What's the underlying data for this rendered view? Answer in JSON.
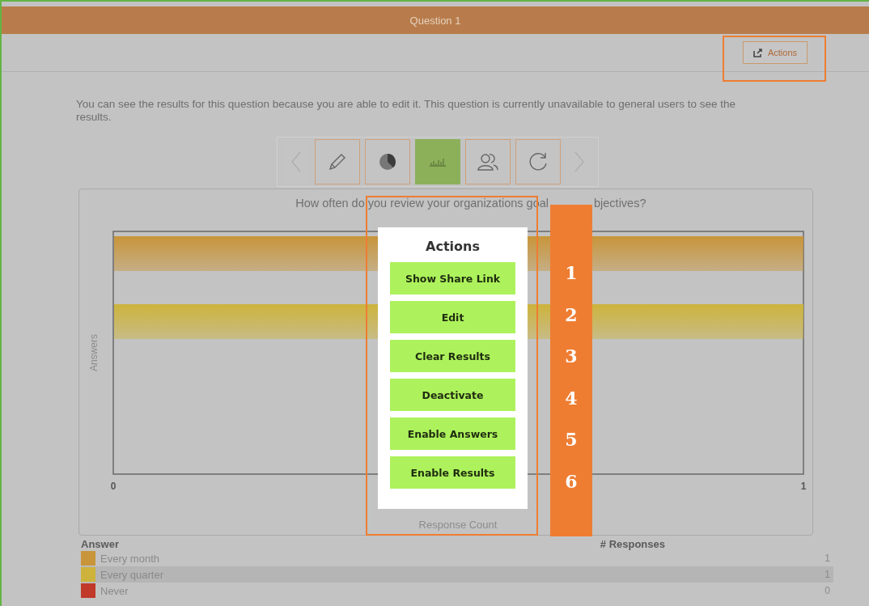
{
  "header": {
    "title": "Question 1"
  },
  "toolbar": {
    "actions_button": "Actions"
  },
  "notice": "You can see the results for this question because you are able to edit it. This question is currently unavailable to general users to see the results.",
  "view_tabs": [
    {
      "kind": "prev",
      "selected": false,
      "disabled": true
    },
    {
      "kind": "edit",
      "selected": false,
      "disabled": false
    },
    {
      "kind": "pie",
      "selected": false,
      "disabled": false
    },
    {
      "kind": "bar",
      "selected": true,
      "disabled": false
    },
    {
      "kind": "people",
      "selected": false,
      "disabled": false
    },
    {
      "kind": "refresh",
      "selected": false,
      "disabled": false
    },
    {
      "kind": "next",
      "selected": false,
      "disabled": true
    }
  ],
  "chart": {
    "question_visible_parts": [
      "How often do you review your organizations goal",
      "bjectives?"
    ],
    "y_axis_label": "Answers",
    "x_axis_label": "Response Count",
    "tick_labels": [
      "0",
      "1"
    ],
    "bars": [
      {
        "level": 1
      },
      {
        "level": 1
      }
    ]
  },
  "legend": {
    "answer_header": "Answer",
    "responses_header": "# Responses",
    "rows": [
      {
        "answer": "Every month",
        "responses": "1",
        "color": "#c8953a",
        "selected": false
      },
      {
        "answer": "Every quarter",
        "responses": "1",
        "color": "#cdb33c",
        "selected": true
      },
      {
        "answer": "Never",
        "responses": "0",
        "color": "#c0392b",
        "selected": false
      }
    ]
  },
  "actions_menu": {
    "title": "Actions",
    "items": [
      "Show Share Link",
      "Edit",
      "Clear Results",
      "Deactivate",
      "Enable Answers",
      "Enable Results"
    ]
  },
  "callout_numbers": [
    "1",
    "2",
    "3",
    "4",
    "5",
    "6"
  ]
}
